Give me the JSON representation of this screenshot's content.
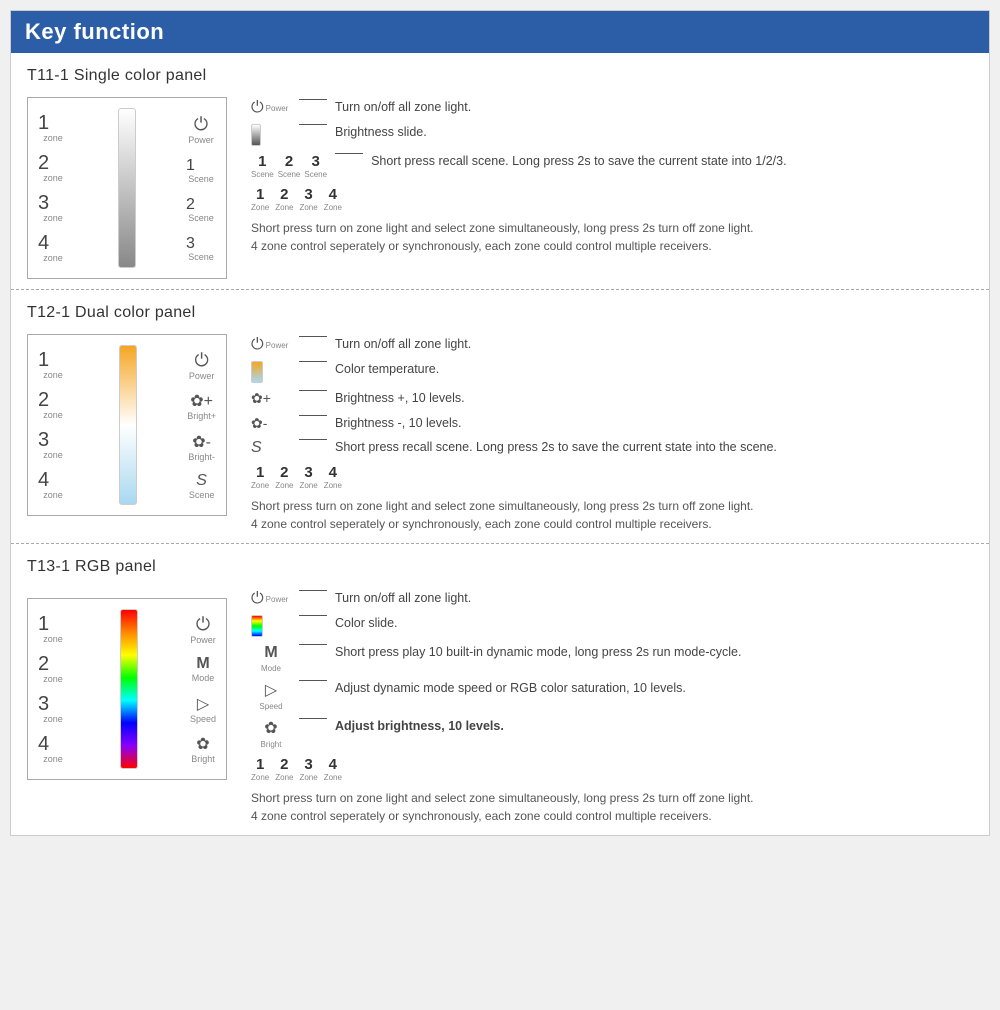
{
  "header": {
    "title": "Key function"
  },
  "sections": [
    {
      "id": "t11",
      "title": "T11-1  Single color panel",
      "slider_type": "gray",
      "zones": [
        "1",
        "2",
        "3",
        "4"
      ],
      "zone_labels": [
        "zone",
        "zone",
        "zone",
        "zone"
      ],
      "right_buttons": [
        "power",
        "1",
        "2",
        "3"
      ],
      "right_labels": [
        "Power",
        "Scene",
        "Scene",
        "Scene"
      ],
      "descriptions": [
        {
          "icon": "power",
          "line": true,
          "text": "Turn on/off all zone light."
        },
        {
          "icon": "gray_slide",
          "line": true,
          "text": "Brightness slide."
        },
        {
          "icon": "123_scene",
          "line": true,
          "text": "Short press recall scene. Long press 2s to save the current state into 1/2/3."
        },
        {
          "icon": "1234_zone",
          "line": false,
          "text": ""
        },
        {
          "icon": "none",
          "line": false,
          "text": "Short press turn on zone light and select zone simultaneously, long press 2s turn off zone light. 4 zone control seperately or synchronously, each zone could control multiple receivers."
        }
      ]
    },
    {
      "id": "t12",
      "title": "T12-1  Dual color panel",
      "slider_type": "warm_cool",
      "zones": [
        "1",
        "2",
        "3",
        "4"
      ],
      "zone_labels": [
        "zone",
        "zone",
        "zone",
        "zone"
      ],
      "right_buttons": [
        "power",
        "bright_plus",
        "bright_minus",
        "S"
      ],
      "right_labels": [
        "Power",
        "Bright+",
        "Bright-",
        "Scene"
      ],
      "descriptions": [
        {
          "icon": "power",
          "line": true,
          "text": "Turn on/off all zone light."
        },
        {
          "icon": "warm_cool_slide",
          "line": true,
          "text": "Color temperature."
        },
        {
          "icon": "bright_plus",
          "line": true,
          "text": "Brightness +, 10 levels."
        },
        {
          "icon": "bright_minus",
          "line": true,
          "text": "Brightness -, 10 levels."
        },
        {
          "icon": "S_scene",
          "line": true,
          "text": "Short press recall scene. Long press 2s to save the current state into the scene."
        },
        {
          "icon": "1234_zone",
          "line": false,
          "text": ""
        },
        {
          "icon": "none",
          "line": false,
          "text": "Short press turn on zone light and select zone simultaneously, long press 2s turn off zone light. 4 zone control seperately or synchronously, each zone could control multiple receivers."
        }
      ]
    },
    {
      "id": "t13",
      "title": "T13-1  RGB panel",
      "slider_type": "rgb",
      "zones": [
        "1",
        "2",
        "3",
        "4"
      ],
      "zone_labels": [
        "zone",
        "zone",
        "zone",
        "zone"
      ],
      "right_buttons": [
        "power",
        "M",
        "speed",
        "bright"
      ],
      "right_labels": [
        "Power",
        "Mode",
        "Speed",
        "Bright"
      ],
      "descriptions": [
        {
          "icon": "power",
          "line": true,
          "text": "Turn on/off all zone light."
        },
        {
          "icon": "rgb_slide",
          "line": true,
          "text": "Color slide."
        },
        {
          "icon": "M_mode",
          "line": true,
          "text": "Short press play 10 built-in dynamic mode, long press 2s run mode-cycle."
        },
        {
          "icon": "speed_icon",
          "line": true,
          "text": "Adjust dynamic mode speed or RGB color saturation, 10 levels."
        },
        {
          "icon": "bright_icon",
          "line": true,
          "text": "Adjust brightness, 10 levels."
        },
        {
          "icon": "1234_zone",
          "line": false,
          "text": ""
        },
        {
          "icon": "none",
          "line": false,
          "text": "Short press turn on zone light and select zone simultaneously, long press 2s turn off zone light. 4 zone control seperately or synchronously, each zone could control multiple receivers."
        }
      ]
    }
  ]
}
